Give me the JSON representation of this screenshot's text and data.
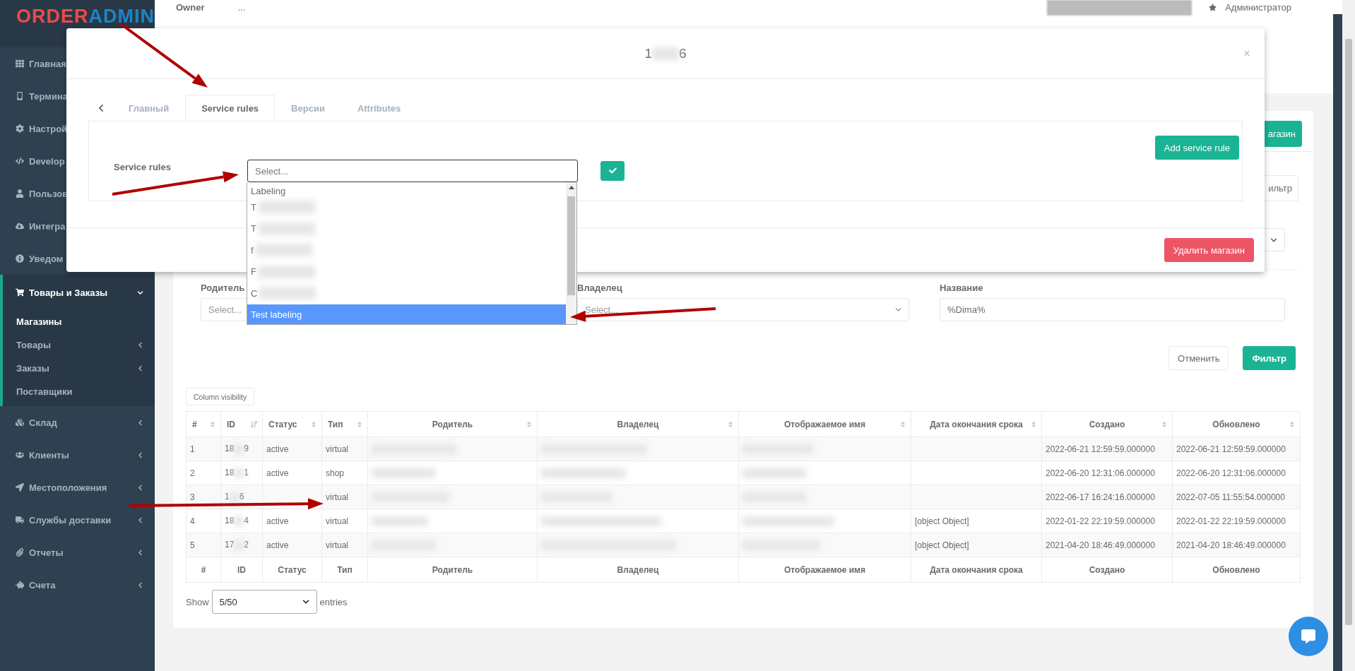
{
  "logo": {
    "part_1": "ORDER",
    "part_2": "ADMIN"
  },
  "sidebar": {
    "items": [
      {
        "label": "Главная"
      },
      {
        "label": "Термина"
      },
      {
        "label": "Настрой"
      },
      {
        "label": "Develop"
      },
      {
        "label": "Пользов"
      },
      {
        "label": "Интегра"
      },
      {
        "label": "Уведом"
      },
      {
        "label": "Товары и Заказы",
        "submenu": true,
        "expanded": true,
        "children": [
          {
            "label": "Магазины",
            "selected": true,
            "submenu": false
          },
          {
            "label": "Товары",
            "selected": false,
            "submenu": true
          },
          {
            "label": "Заказы",
            "selected": false,
            "submenu": true
          },
          {
            "label": "Поставщики",
            "selected": false,
            "submenu": false
          }
        ]
      },
      {
        "label": "Склад",
        "submenu": true
      },
      {
        "label": "Клиенты",
        "submenu": true
      },
      {
        "label": "Местоположения",
        "submenu": true
      },
      {
        "label": "Службы доставки",
        "submenu": true
      },
      {
        "label": "Отчеты",
        "submenu": true
      },
      {
        "label": "Счета",
        "submenu": true
      }
    ]
  },
  "header": {
    "owner_label": "Owner",
    "owner_value": "...",
    "user": "Администратор"
  },
  "page": {
    "add_button": "агазин",
    "filter_toggle": "ильтр",
    "filters": [
      {
        "label": "Родитель",
        "placeholder": "Select..."
      },
      {
        "label": "Владелец",
        "placeholder": "Select..."
      },
      {
        "label": "Название",
        "value": "%Dima%"
      }
    ],
    "cancel_button": "Отменить",
    "filter_button": "Фильтр",
    "column_visibility": "Column visibility"
  },
  "table": {
    "columns": [
      "#",
      "ID",
      "Статус",
      "Тип",
      "Родитель",
      "Владелец",
      "Отображаемое имя",
      "Дата окончания срока",
      "Создано",
      "Обновлено"
    ],
    "rows": [
      {
        "num": "1",
        "id_start": "18",
        "id_end": "9",
        "status": "active",
        "type": "virtual",
        "created": "2022-06-21 12:59:59.000000",
        "updated": "2022-06-21 12:59:59.000000"
      },
      {
        "num": "2",
        "id_start": "18",
        "id_end": "1",
        "status": "active",
        "type": "shop",
        "created": "2022-06-20 12:31:06.000000",
        "updated": "2022-06-20 12:31:06.000000"
      },
      {
        "num": "3",
        "id_start": "1",
        "id_end": "6",
        "type": "virtual",
        "created": "2022-06-17 16:24:16.000000",
        "updated": "2022-07-05 11:55:54.000000"
      },
      {
        "num": "4",
        "id_start": "18",
        "id_end": "4",
        "status": "active",
        "type": "virtual",
        "expiry": "[object Object]",
        "created": "2022-01-22 22:19:59.000000",
        "updated": "2022-01-22 22:19:59.000000"
      },
      {
        "num": "5",
        "id_start": "17",
        "id_end": "2",
        "status": "active",
        "type": "virtual",
        "expiry": "[object Object]",
        "created": "2021-04-20 18:46:49.000000",
        "updated": "2021-04-20 18:46:49.000000"
      }
    ],
    "footer": [
      "#",
      "ID",
      "Статус",
      "Тип",
      "Родитель",
      "Владелец",
      "Отображаемое имя",
      "Дата окончания срока",
      "Создано",
      "Обновлено"
    ]
  },
  "pagination": {
    "show": "Show",
    "page_size": "5/50",
    "entries": "entries"
  },
  "modal": {
    "title_start": "1",
    "title_end": "6",
    "close": "×",
    "tabs": [
      {
        "label": "Главный",
        "selected": false
      },
      {
        "label": "Service rules",
        "selected": true
      },
      {
        "label": "Версии",
        "selected": false
      },
      {
        "label": "Attributes",
        "selected": false
      }
    ],
    "field_label": "Service rules",
    "select_placeholder": "Select...",
    "add_button": "Add service rule",
    "delete_button": "Удалить магазин",
    "options": [
      {
        "label": "Labeling",
        "selected": false
      },
      {
        "label": "T",
        "selected": false
      },
      {
        "label": "T",
        "selected": false
      },
      {
        "label": "f",
        "selected": false
      },
      {
        "label": "F",
        "selected": false
      },
      {
        "label": "C",
        "selected": false
      },
      {
        "label": "Test labeling",
        "selected": true
      }
    ]
  }
}
